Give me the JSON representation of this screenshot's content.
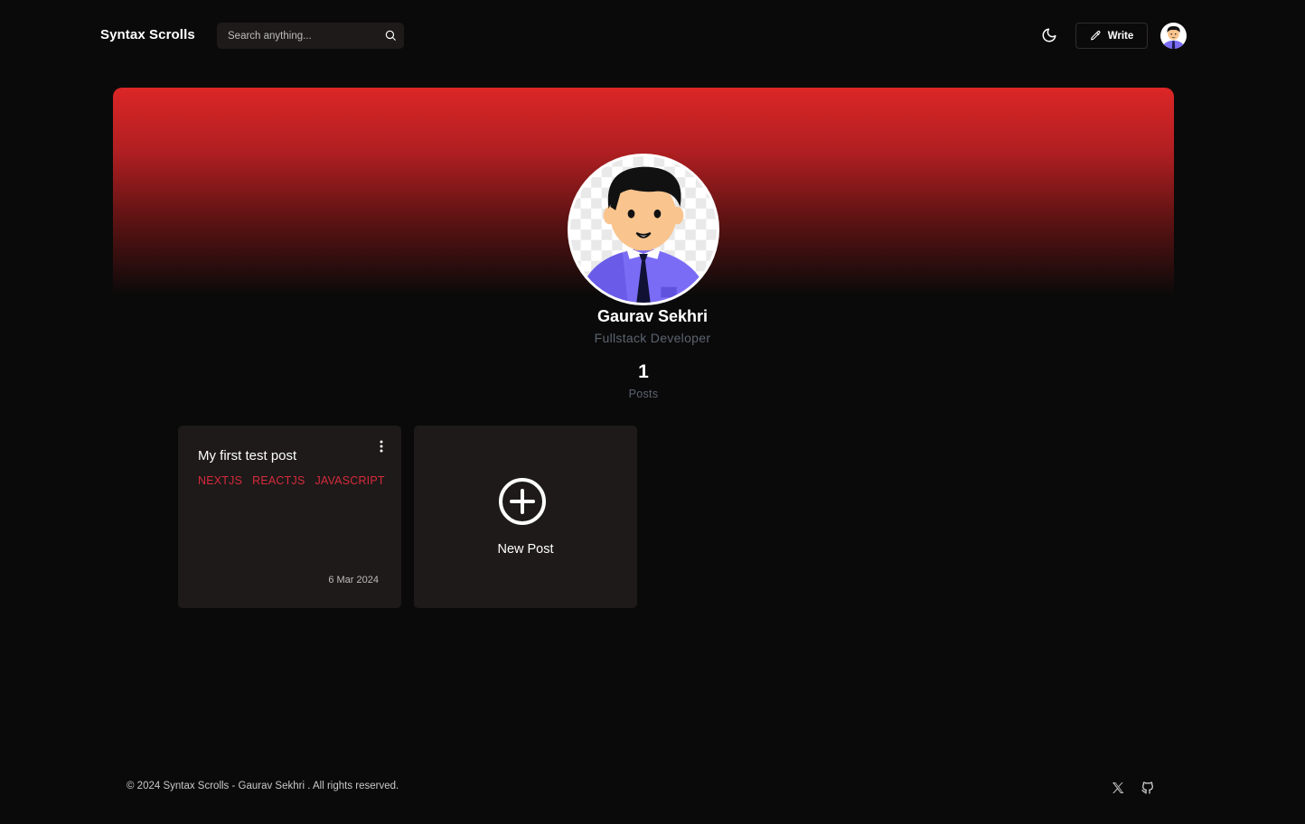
{
  "header": {
    "brand": "Syntax Scrolls",
    "search_placeholder": "Search anything...",
    "write_label": "Write"
  },
  "profile": {
    "name": "Gaurav Sekhri",
    "role": "Fullstack Developer",
    "posts_count": "1",
    "posts_label": "Posts"
  },
  "posts": [
    {
      "title": "My first test post",
      "tags": [
        "NEXTJS",
        "REACTJS",
        "JAVASCRIPT"
      ],
      "date": "6 Mar 2024"
    }
  ],
  "new_post_label": "New Post",
  "footer": {
    "copyright": "© 2024 Syntax Scrolls - Gaurav Sekhri . All rights reserved."
  },
  "colors": {
    "accent": "#dc2626",
    "tag": "#d72a3c",
    "card_bg": "#1d1a19",
    "page_bg": "#0b0a0a"
  },
  "icons": [
    "search-icon",
    "moon-icon",
    "pencil-icon",
    "kebab-menu-icon",
    "plus-circle-icon",
    "x-twitter-icon",
    "github-icon"
  ]
}
